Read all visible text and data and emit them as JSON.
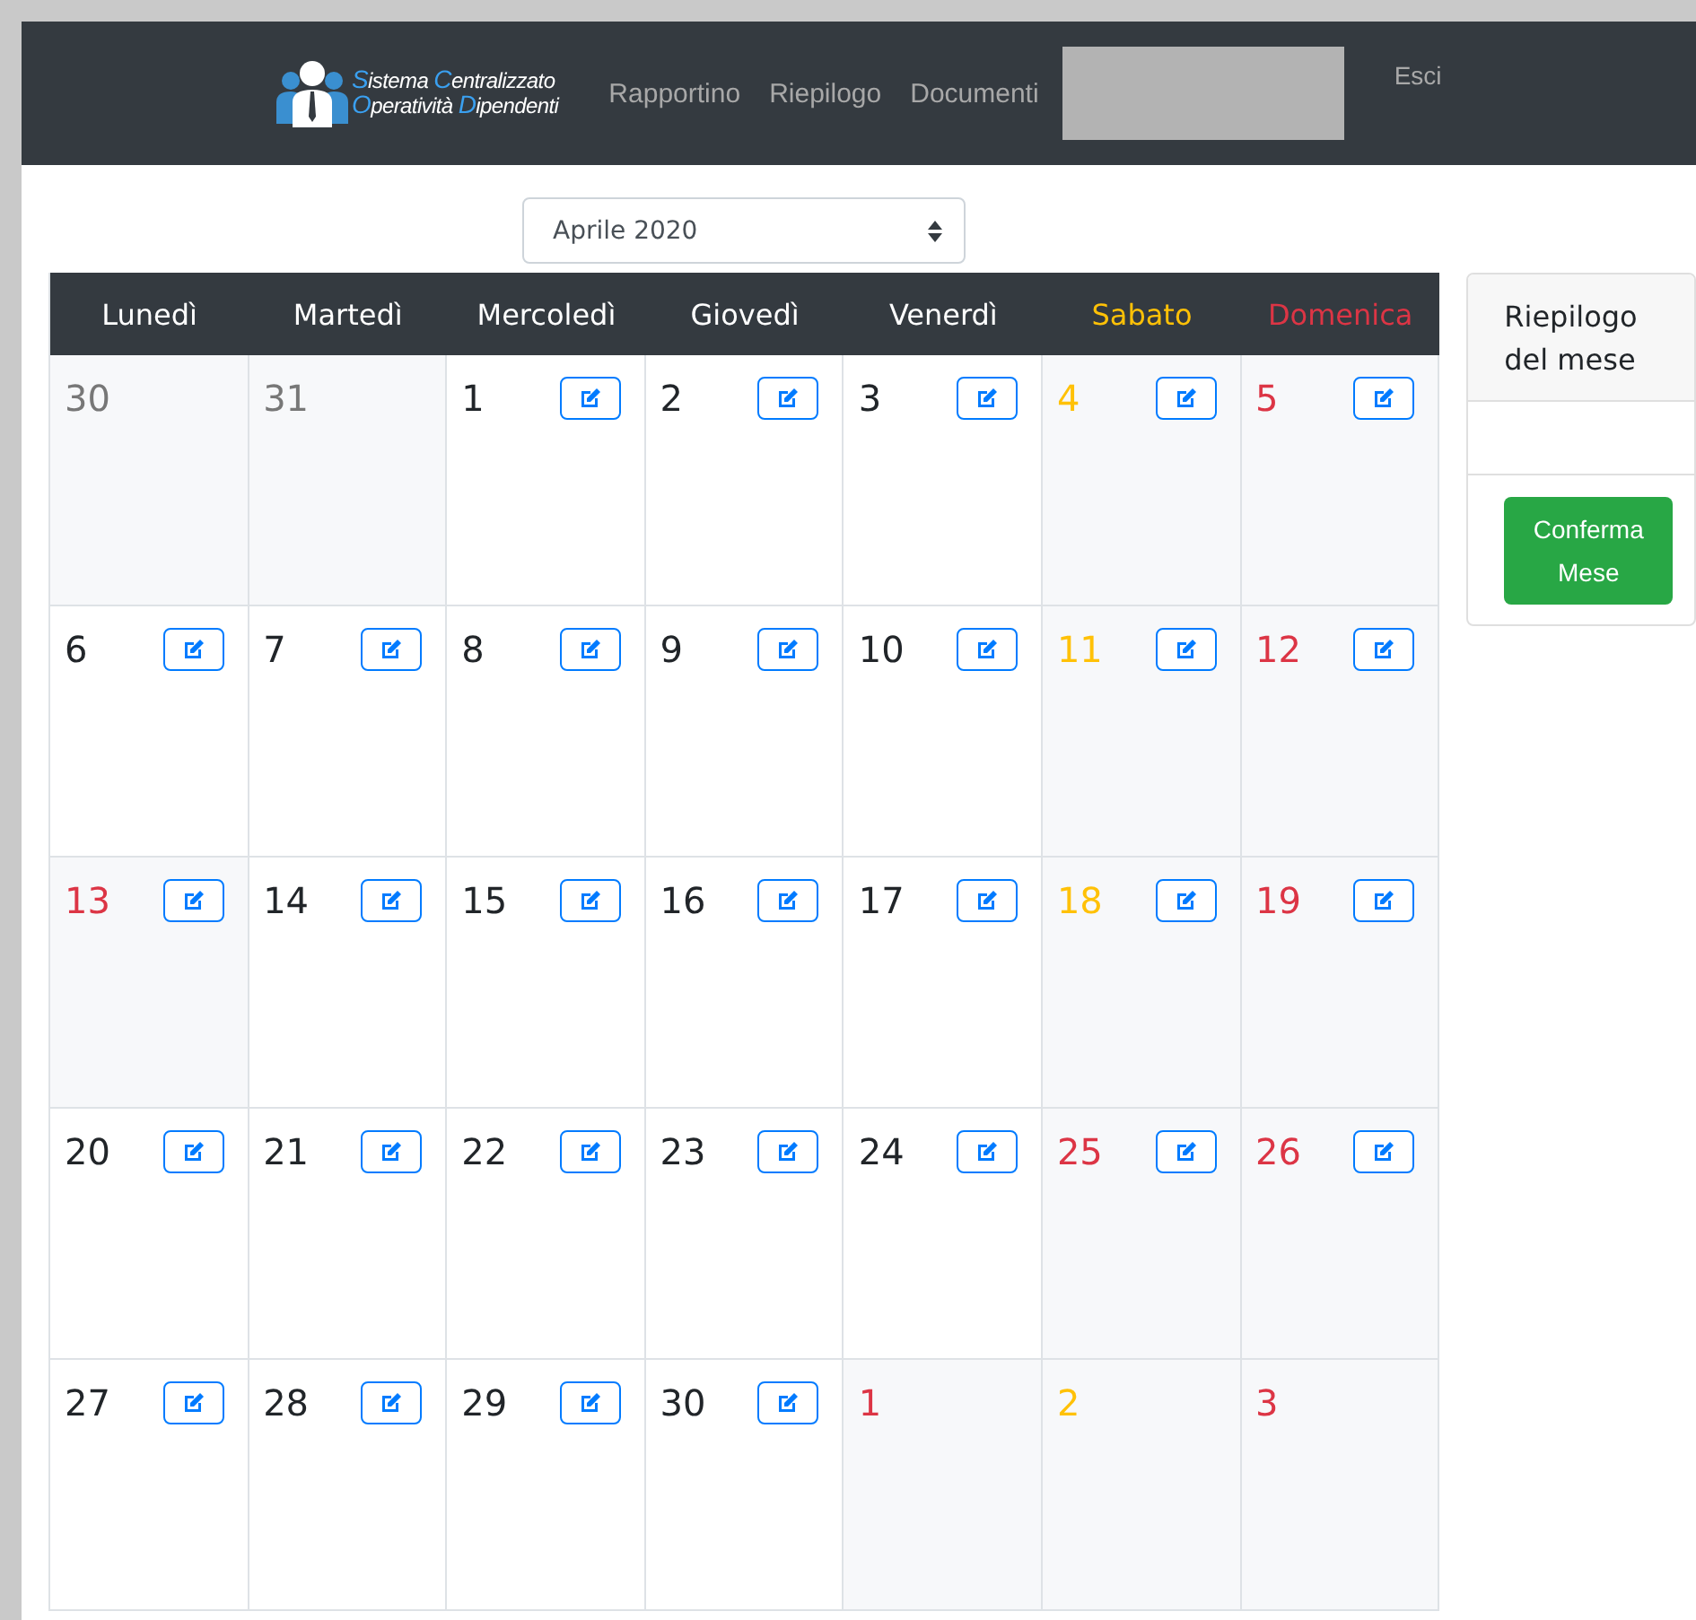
{
  "navbar": {
    "logo_lines": [
      "Sistema Centralizzato",
      "Operatività Dipendenti"
    ],
    "links": [
      "Rapportino",
      "Riepilogo",
      "Documenti"
    ],
    "logout": "Esci"
  },
  "month_select": {
    "value": "Aprile 2020"
  },
  "calendar": {
    "weekdays": [
      {
        "label": "Lunedì",
        "kind": "work"
      },
      {
        "label": "Martedì",
        "kind": "work"
      },
      {
        "label": "Mercoledì",
        "kind": "work"
      },
      {
        "label": "Giovedì",
        "kind": "work"
      },
      {
        "label": "Venerdì",
        "kind": "work"
      },
      {
        "label": "Sabato",
        "kind": "saturday"
      },
      {
        "label": "Domenica",
        "kind": "holiday"
      }
    ],
    "days": [
      {
        "day": "30",
        "kind": "other",
        "editable": false
      },
      {
        "day": "31",
        "kind": "other",
        "editable": false
      },
      {
        "day": "1",
        "kind": "work",
        "editable": true
      },
      {
        "day": "2",
        "kind": "work",
        "editable": true
      },
      {
        "day": "3",
        "kind": "work",
        "editable": true
      },
      {
        "day": "4",
        "kind": "saturday",
        "editable": true
      },
      {
        "day": "5",
        "kind": "holiday",
        "editable": true
      },
      {
        "day": "6",
        "kind": "work",
        "editable": true
      },
      {
        "day": "7",
        "kind": "work",
        "editable": true
      },
      {
        "day": "8",
        "kind": "work",
        "editable": true
      },
      {
        "day": "9",
        "kind": "work",
        "editable": true
      },
      {
        "day": "10",
        "kind": "work",
        "editable": true
      },
      {
        "day": "11",
        "kind": "saturday",
        "editable": true
      },
      {
        "day": "12",
        "kind": "holiday",
        "editable": true
      },
      {
        "day": "13",
        "kind": "holiday",
        "editable": true
      },
      {
        "day": "14",
        "kind": "work",
        "editable": true
      },
      {
        "day": "15",
        "kind": "work",
        "editable": true
      },
      {
        "day": "16",
        "kind": "work",
        "editable": true
      },
      {
        "day": "17",
        "kind": "work",
        "editable": true
      },
      {
        "day": "18",
        "kind": "saturday",
        "editable": true
      },
      {
        "day": "19",
        "kind": "holiday",
        "editable": true
      },
      {
        "day": "20",
        "kind": "work",
        "editable": true
      },
      {
        "day": "21",
        "kind": "work",
        "editable": true
      },
      {
        "day": "22",
        "kind": "work",
        "editable": true
      },
      {
        "day": "23",
        "kind": "work",
        "editable": true
      },
      {
        "day": "24",
        "kind": "work",
        "editable": true
      },
      {
        "day": "25",
        "kind": "holiday",
        "editable": true
      },
      {
        "day": "26",
        "kind": "holiday",
        "editable": true
      },
      {
        "day": "27",
        "kind": "work",
        "editable": true
      },
      {
        "day": "28",
        "kind": "work",
        "editable": true
      },
      {
        "day": "29",
        "kind": "work",
        "editable": true
      },
      {
        "day": "30",
        "kind": "work",
        "editable": true
      },
      {
        "day": "1",
        "kind": "holiday",
        "editable": false
      },
      {
        "day": "2",
        "kind": "saturday",
        "editable": false
      },
      {
        "day": "3",
        "kind": "holiday",
        "editable": false
      }
    ]
  },
  "summary": {
    "title": "Riepilogo del mese",
    "confirm_button": "Conferma Mese"
  }
}
